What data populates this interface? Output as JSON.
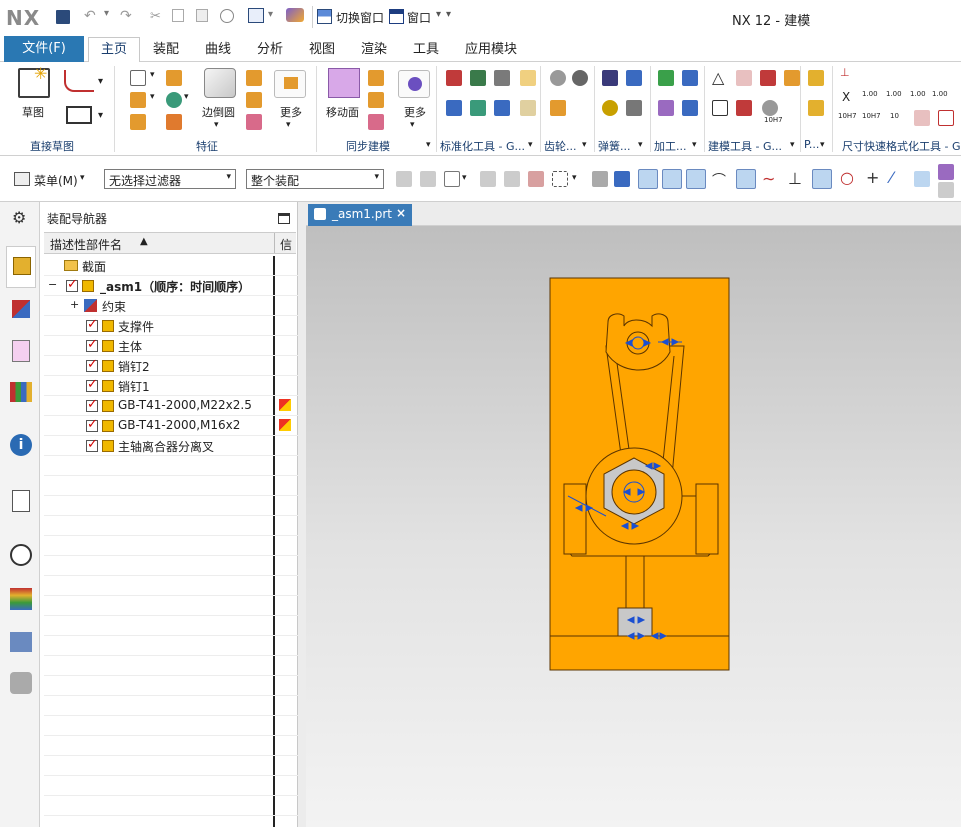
{
  "title_bar": {
    "logo": "NX",
    "switch_window": "切换窗口",
    "window_menu": "窗口",
    "app_title": "NX 12 - 建模"
  },
  "menu_tabs": {
    "file": "文件(F)",
    "tabs": [
      "主页",
      "装配",
      "曲线",
      "分析",
      "视图",
      "渲染",
      "工具",
      "应用模块"
    ],
    "active": "主页"
  },
  "ribbon": {
    "sketch": "草图",
    "edge_blend": "边倒圆",
    "more1": "更多",
    "move_face": "移动面",
    "more2": "更多",
    "groups": {
      "direct_sketch": "直接草图",
      "feature": "特征",
      "sync_modeling": "同步建模",
      "standard_tools": "标准化工具 - G...",
      "gear": "齿轮...",
      "spring": "弹簧...",
      "machining": "加工...",
      "modeling_tools": "建模工具 - G...",
      "p": "P...",
      "dim_format": "尺寸快速格式化工具 - G"
    },
    "tolerance_labels": [
      "1.00",
      "1.00",
      "1.00",
      "1.00",
      "10H7",
      "10H7",
      "10",
      "10H7"
    ]
  },
  "toolbar": {
    "menu": "菜单(M)",
    "filter": "无选择过滤器",
    "scope": "整个装配"
  },
  "navigator": {
    "title": "装配导航器",
    "col_name": "描述性部件名",
    "col_info": "信",
    "rows": [
      {
        "label": "截面"
      },
      {
        "label": "_asm1（顺序：时间顺序）"
      },
      {
        "label": "约束"
      },
      {
        "label": "支撑件"
      },
      {
        "label": "主体"
      },
      {
        "label": "销钉2"
      },
      {
        "label": "销钉1"
      },
      {
        "label": "GB-T41-2000,M22x2.5"
      },
      {
        "label": "GB-T41-2000,M16x2"
      },
      {
        "label": "主轴离合器分离叉"
      }
    ]
  },
  "graphics": {
    "tab": "_asm1.prt"
  },
  "colors": {
    "file_tab": "#1f6ea8",
    "model_orange": "#ffa500",
    "model_edge": "#5a3400",
    "constraint_blue": "#1b4fd1"
  }
}
